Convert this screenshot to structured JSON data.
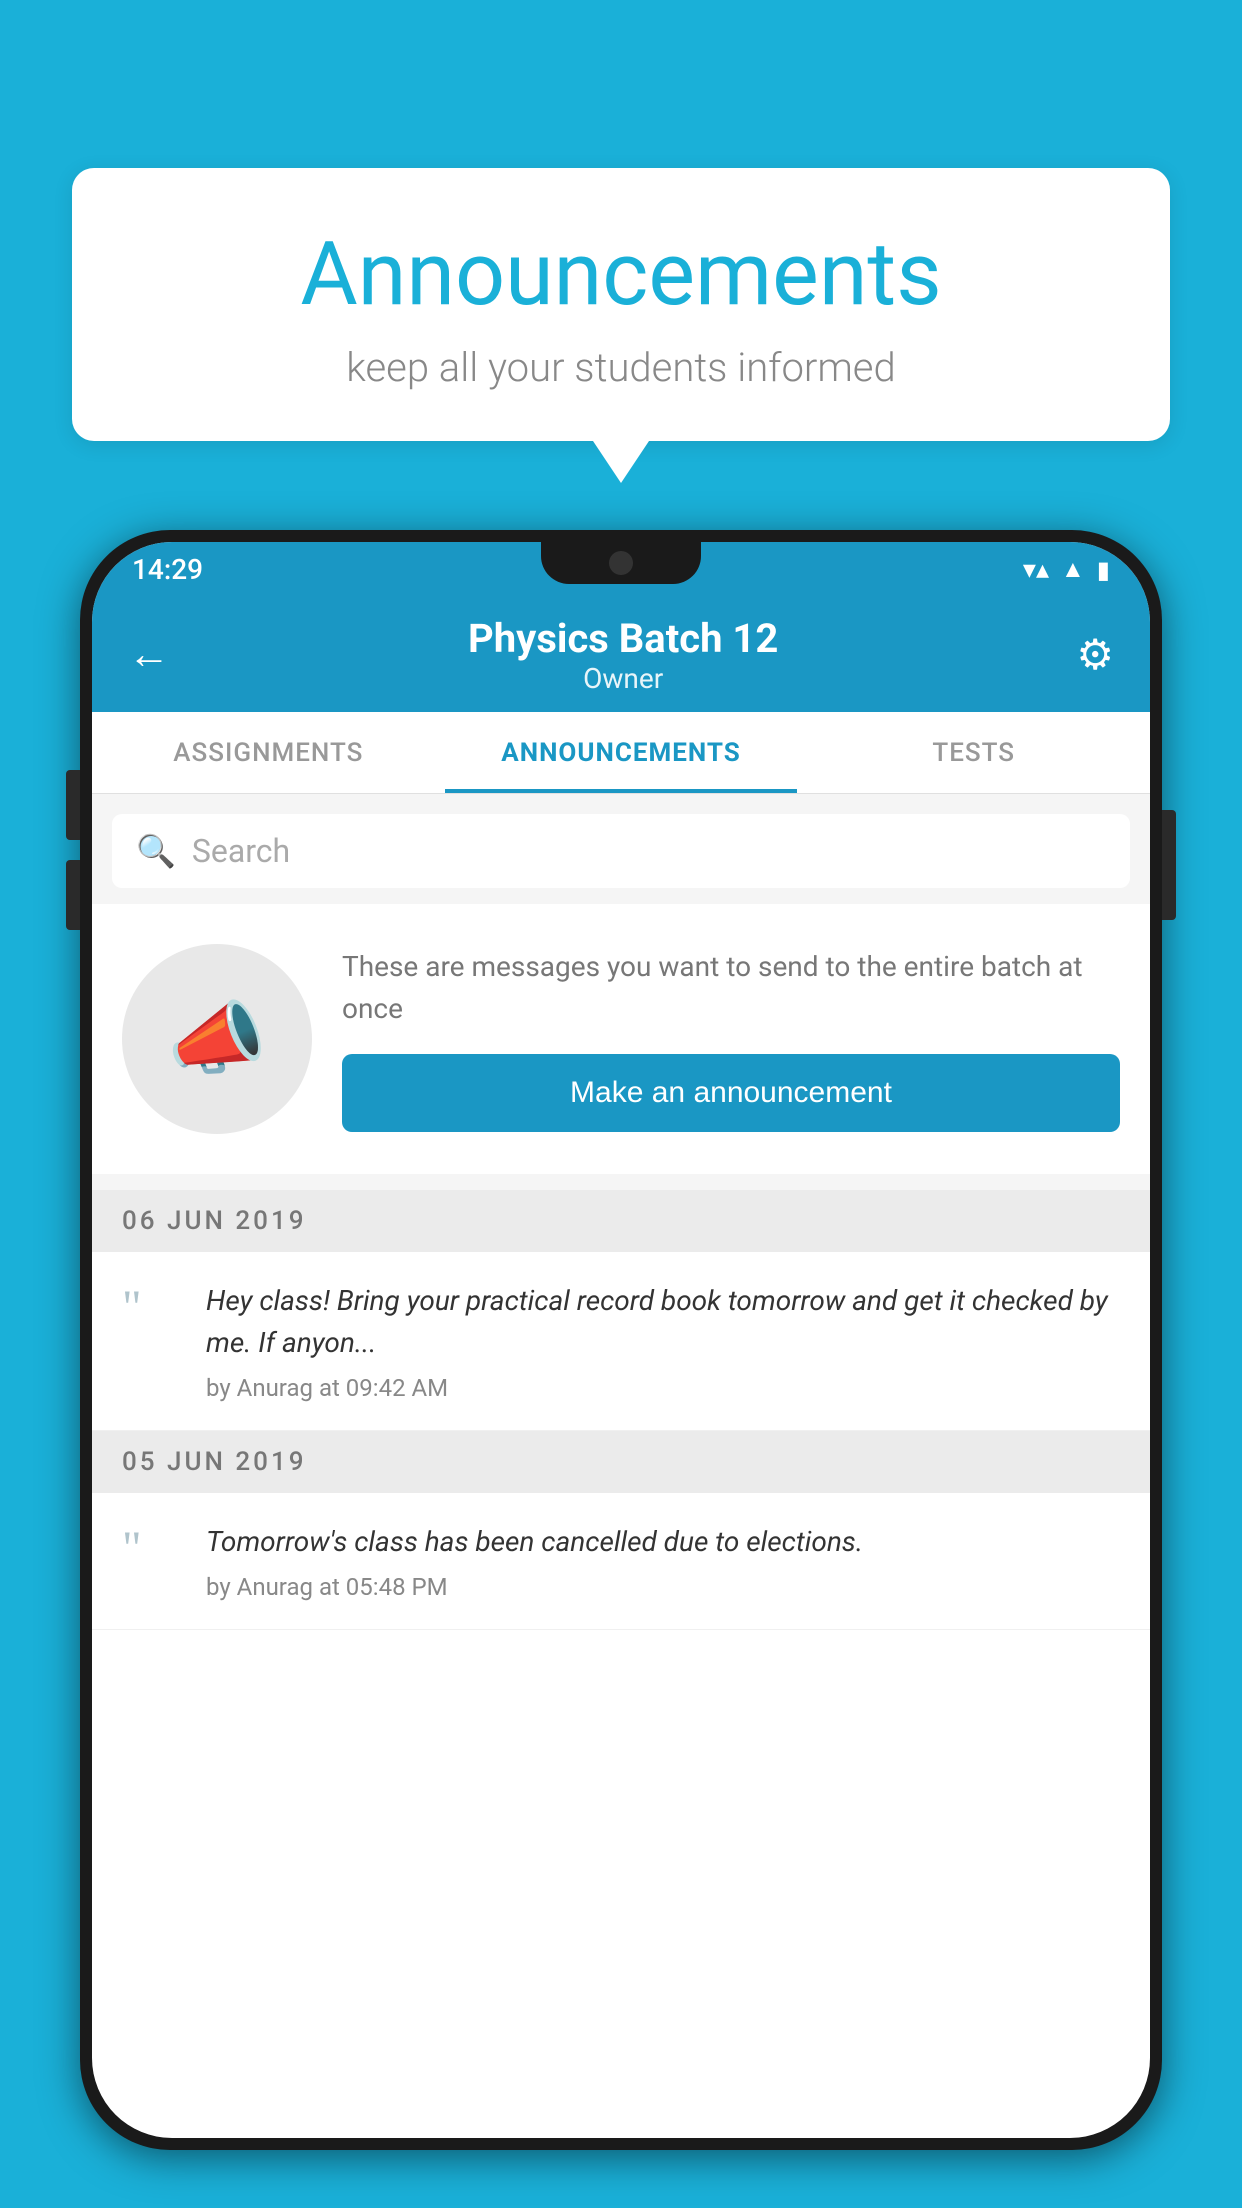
{
  "background_color": "#1ab0d8",
  "bubble": {
    "title": "Announcements",
    "subtitle": "keep all your students informed"
  },
  "status_bar": {
    "time": "14:29",
    "wifi": "▼",
    "signal": "◀",
    "battery": "▮"
  },
  "header": {
    "title": "Physics Batch 12",
    "subtitle": "Owner",
    "back_label": "←",
    "gear_label": "⚙"
  },
  "tabs": [
    {
      "label": "ASSIGNMENTS",
      "active": false
    },
    {
      "label": "ANNOUNCEMENTS",
      "active": true
    },
    {
      "label": "TESTS",
      "active": false
    }
  ],
  "search": {
    "placeholder": "Search"
  },
  "cta": {
    "description": "These are messages you want to send to the entire batch at once",
    "button_label": "Make an announcement"
  },
  "announcements": [
    {
      "date": "06  JUN  2019",
      "text": "Hey class! Bring your practical record book tomorrow and get it checked by me. If anyon...",
      "meta": "by Anurag at 09:42 AM"
    },
    {
      "date": "05  JUN  2019",
      "text": "Tomorrow's class has been cancelled due to elections.",
      "meta": "by Anurag at 05:48 PM"
    }
  ]
}
